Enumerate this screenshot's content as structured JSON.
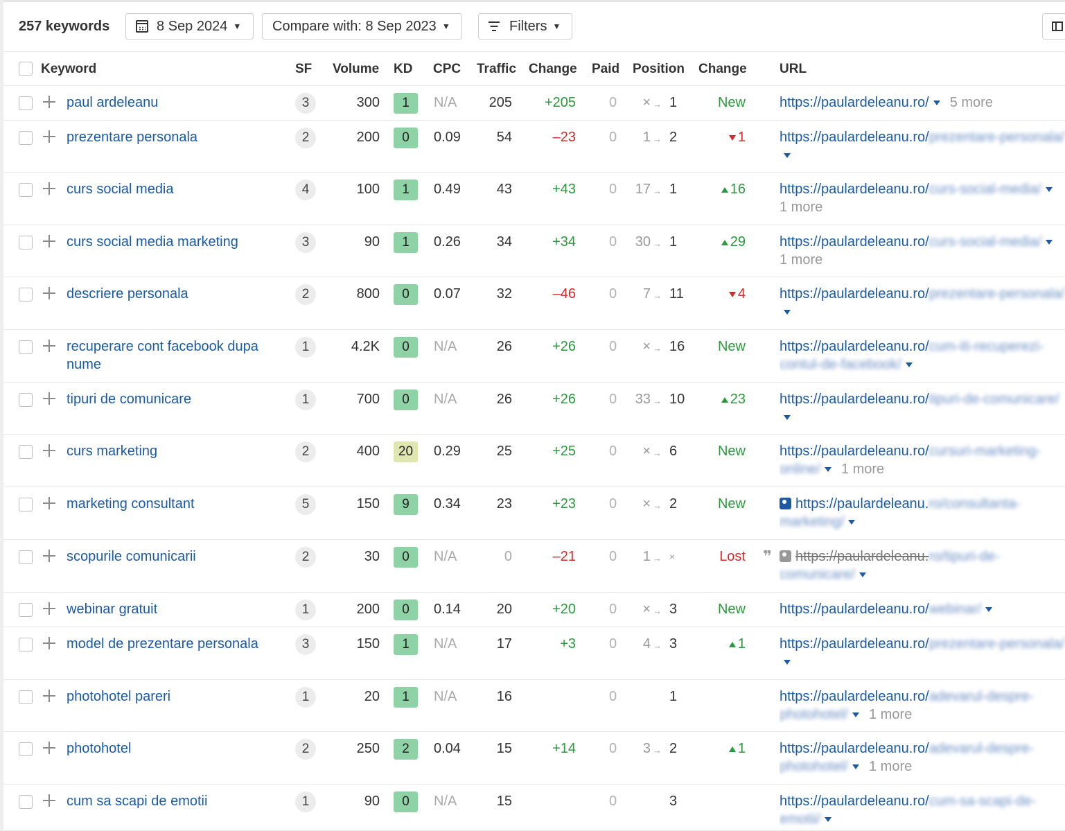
{
  "toolbar": {
    "keyword_count": "257 keywords",
    "date": "8 Sep 2024",
    "compare": "Compare with: 8 Sep 2023",
    "filters": "Filters"
  },
  "columns": {
    "keyword": "Keyword",
    "sf": "SF",
    "volume": "Volume",
    "kd": "KD",
    "cpc": "CPC",
    "traffic": "Traffic",
    "change": "Change",
    "paid": "Paid",
    "position": "Position",
    "pos_change": "Change",
    "url": "URL"
  },
  "colors": {
    "kd_green": "#8fd2a5",
    "kd_yellow": "#dfe6b0",
    "positive": "#2a9a3c",
    "negative": "#d42a2a",
    "link": "#1a5aa6"
  },
  "rows": [
    {
      "keyword": "paul ardeleanu",
      "sf": "3",
      "volume": "300",
      "kd": "1",
      "cpc": "N/A",
      "traffic": "205",
      "change": "+205",
      "paid": "0",
      "pos_from": "×",
      "pos_to": "1",
      "pos_change": "New",
      "url": "https://paulardeleanu.ro/",
      "url_blur": "",
      "more": "5 more"
    },
    {
      "keyword": "prezentare personala",
      "sf": "2",
      "volume": "200",
      "kd": "0",
      "cpc": "0.09",
      "traffic": "54",
      "change": "–23",
      "paid": "0",
      "pos_from": "1",
      "pos_to": "2",
      "pos_change": "1",
      "url": "https://paulardeleanu.ro/",
      "url_blur": "prezentare-personala/",
      "more": ""
    },
    {
      "keyword": "curs social media",
      "sf": "4",
      "volume": "100",
      "kd": "1",
      "cpc": "0.49",
      "traffic": "43",
      "change": "+43",
      "paid": "0",
      "pos_from": "17",
      "pos_to": "1",
      "pos_change": "16",
      "url": "https://paulardeleanu.ro/",
      "url_blur": "curs-social-media/",
      "more": "1 more"
    },
    {
      "keyword": "curs social media marketing",
      "sf": "3",
      "volume": "90",
      "kd": "1",
      "cpc": "0.26",
      "traffic": "34",
      "change": "+34",
      "paid": "0",
      "pos_from": "30",
      "pos_to": "1",
      "pos_change": "29",
      "url": "https://paulardeleanu.ro/",
      "url_blur": "curs-social-media/",
      "more": "1 more"
    },
    {
      "keyword": "descriere personala",
      "sf": "2",
      "volume": "800",
      "kd": "0",
      "cpc": "0.07",
      "traffic": "32",
      "change": "–46",
      "paid": "0",
      "pos_from": "7",
      "pos_to": "11",
      "pos_change": "4",
      "url": "https://paulardeleanu.ro/",
      "url_blur": "prezentare-personala/",
      "more": ""
    },
    {
      "keyword": "recuperare cont facebook dupa nume",
      "sf": "1",
      "volume": "4.2K",
      "kd": "0",
      "cpc": "N/A",
      "traffic": "26",
      "change": "+26",
      "paid": "0",
      "pos_from": "×",
      "pos_to": "16",
      "pos_change": "New",
      "url": "https://paulardeleanu.ro/",
      "url_blur": "cum-iti-recuperezi-contul-de-facebook/",
      "more": ""
    },
    {
      "keyword": "tipuri de comunicare",
      "sf": "1",
      "volume": "700",
      "kd": "0",
      "cpc": "N/A",
      "traffic": "26",
      "change": "+26",
      "paid": "0",
      "pos_from": "33",
      "pos_to": "10",
      "pos_change": "23",
      "url": "https://paulardeleanu.ro/",
      "url_blur": "tipuri-de-comunicare/",
      "more": ""
    },
    {
      "keyword": "curs marketing",
      "sf": "2",
      "volume": "400",
      "kd": "20",
      "cpc": "0.29",
      "traffic": "25",
      "change": "+25",
      "paid": "0",
      "pos_from": "×",
      "pos_to": "6",
      "pos_change": "New",
      "url": "https://paulardeleanu.ro/",
      "url_blur": "cursuri-marketing-online/",
      "more": "1 more"
    },
    {
      "keyword": "marketing consultant",
      "sf": "5",
      "volume": "150",
      "kd": "9",
      "cpc": "0.34",
      "traffic": "23",
      "change": "+23",
      "paid": "0",
      "pos_from": "×",
      "pos_to": "2",
      "pos_change": "New",
      "url": "https://paulardeleanu.",
      "url_blur": "ro/consultanta-marketing/",
      "more": ""
    },
    {
      "keyword": "scopurile comunicarii",
      "sf": "2",
      "volume": "30",
      "kd": "0",
      "cpc": "N/A",
      "traffic": "0",
      "change": "–21",
      "paid": "0",
      "pos_from": "1",
      "pos_to": "×",
      "pos_change": "Lost",
      "url": "https://paulardeleanu.",
      "url_blur": "ro/tipuri-de-comunicare/",
      "more": ""
    },
    {
      "keyword": "webinar gratuit",
      "sf": "1",
      "volume": "200",
      "kd": "0",
      "cpc": "0.14",
      "traffic": "20",
      "change": "+20",
      "paid": "0",
      "pos_from": "×",
      "pos_to": "3",
      "pos_change": "New",
      "url": "https://paulardeleanu.ro/",
      "url_blur": "webinar/",
      "more": ""
    },
    {
      "keyword": "model de prezentare personala",
      "sf": "3",
      "volume": "150",
      "kd": "1",
      "cpc": "N/A",
      "traffic": "17",
      "change": "+3",
      "paid": "0",
      "pos_from": "4",
      "pos_to": "3",
      "pos_change": "1",
      "url": "https://paulardeleanu.ro/",
      "url_blur": "prezentare-personala/",
      "more": ""
    },
    {
      "keyword": "photohotel pareri",
      "sf": "1",
      "volume": "20",
      "kd": "1",
      "cpc": "N/A",
      "traffic": "16",
      "change": "",
      "paid": "0",
      "pos_from": "",
      "pos_to": "1",
      "pos_change": "",
      "url": "https://paulardeleanu.ro/",
      "url_blur": "adevarul-despre-photohotel/",
      "more": "1 more"
    },
    {
      "keyword": "photohotel",
      "sf": "2",
      "volume": "250",
      "kd": "2",
      "cpc": "0.04",
      "traffic": "15",
      "change": "+14",
      "paid": "0",
      "pos_from": "3",
      "pos_to": "2",
      "pos_change": "1",
      "url": "https://paulardeleanu.ro/",
      "url_blur": "adevarul-despre-photohotel/",
      "more": "1 more"
    },
    {
      "keyword": "cum sa scapi de emotii",
      "sf": "1",
      "volume": "90",
      "kd": "0",
      "cpc": "N/A",
      "traffic": "15",
      "change": "",
      "paid": "0",
      "pos_from": "",
      "pos_to": "3",
      "pos_change": "",
      "url": "https://paulardeleanu.ro/",
      "url_blur": "cum-sa-scapi-de-emotii/",
      "more": ""
    }
  ]
}
